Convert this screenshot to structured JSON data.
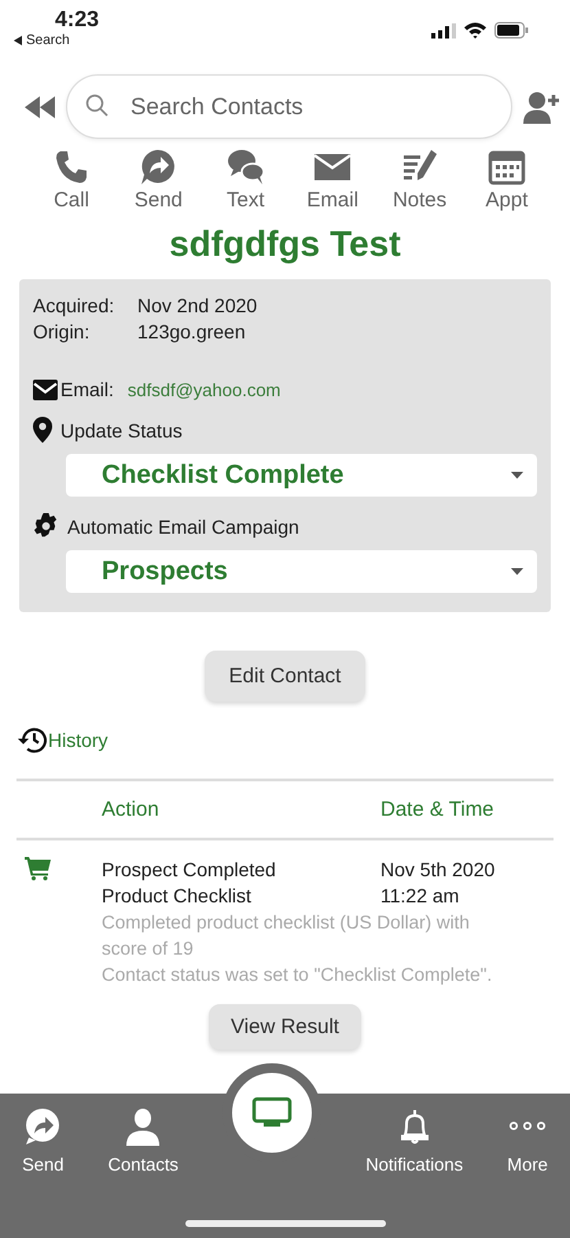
{
  "status_bar": {
    "time": "4:23",
    "back_label": "Search"
  },
  "search": {
    "placeholder": "Search Contacts"
  },
  "actions": [
    {
      "label": "Call",
      "kind": "call"
    },
    {
      "label": "Send",
      "kind": "send"
    },
    {
      "label": "Text",
      "kind": "text"
    },
    {
      "label": "Email",
      "kind": "email"
    },
    {
      "label": "Notes",
      "kind": "notes"
    },
    {
      "label": "Appt",
      "kind": "appt"
    }
  ],
  "contact_name": "sdfgdfgs Test",
  "details": [
    {
      "label": "Acquired:",
      "value": "Nov 2nd 2020"
    },
    {
      "label": "Origin:",
      "value": "123go.green"
    }
  ],
  "email": {
    "label": "Email:",
    "value": "sdfsdf@yahoo.com"
  },
  "status": {
    "label": "Update Status",
    "value": "Checklist Complete"
  },
  "campaign": {
    "label": "Automatic Email Campaign",
    "value": "Prospects"
  },
  "edit_button": "Edit Contact",
  "history": {
    "title": "History",
    "columns": [
      "Action",
      "Date & Time"
    ],
    "rows": [
      {
        "kind": "cart",
        "action": "Prospect Completed Product Checklist",
        "date": "Nov 5th 2020",
        "time": "11:22 am",
        "details": [
          "Completed product checklist (US Dollar) with score of 19",
          "Contact status was set to \"Checklist Complete\"."
        ],
        "button": "View Result"
      }
    ]
  },
  "bottom_nav": [
    {
      "label": "Send",
      "kind": "send"
    },
    {
      "label": "Contacts",
      "kind": "contacts"
    },
    {
      "kind": "monitor"
    },
    {
      "label": "Notifications",
      "kind": "bell"
    },
    {
      "label": "More",
      "kind": "more"
    }
  ]
}
